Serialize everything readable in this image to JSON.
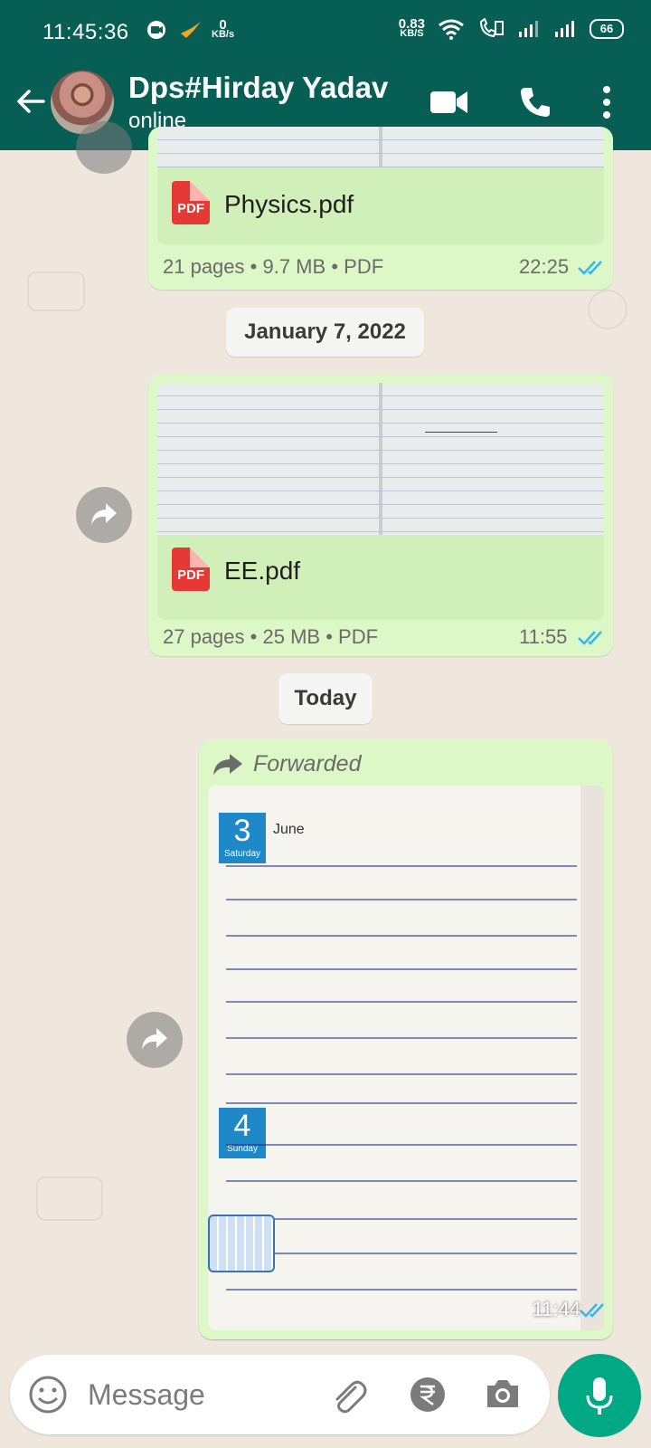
{
  "status_bar": {
    "time": "11:45:36",
    "net_speed_1_value": "0",
    "net_speed_1_unit": "KB/s",
    "net_speed_2_value": "0.83",
    "net_speed_2_unit": "KB/S",
    "battery": "66"
  },
  "header": {
    "contact_name": "Dps#Hirday Yadav",
    "status": "online"
  },
  "messages": [
    {
      "file_name": "Physics.pdf",
      "pages": "21 pages",
      "size": "9.7 MB",
      "type": "PDF",
      "time": "22:25",
      "badge": "PDF",
      "read": true
    },
    {
      "file_name": "EE.pdf",
      "pages": "27 pages",
      "size": "25 MB",
      "type": "PDF",
      "time": "11:55",
      "badge": "PDF",
      "read": true
    },
    {
      "forwarded_label": "Forwarded",
      "time": "11:44",
      "read": true,
      "photo_month": "June",
      "photo_day_1": "3",
      "photo_weekday_1": "Saturday",
      "photo_day_2": "4",
      "photo_weekday_2": "Sunday"
    }
  ],
  "meta_sep": "•",
  "date_chips": [
    "January 7, 2022",
    "Today"
  ],
  "composer": {
    "placeholder": "Message"
  },
  "colors": {
    "header": "#075e54",
    "bubble_out": "#dcf8c6",
    "mic_button": "#00a884",
    "read_ticks": "#34b7f1"
  }
}
